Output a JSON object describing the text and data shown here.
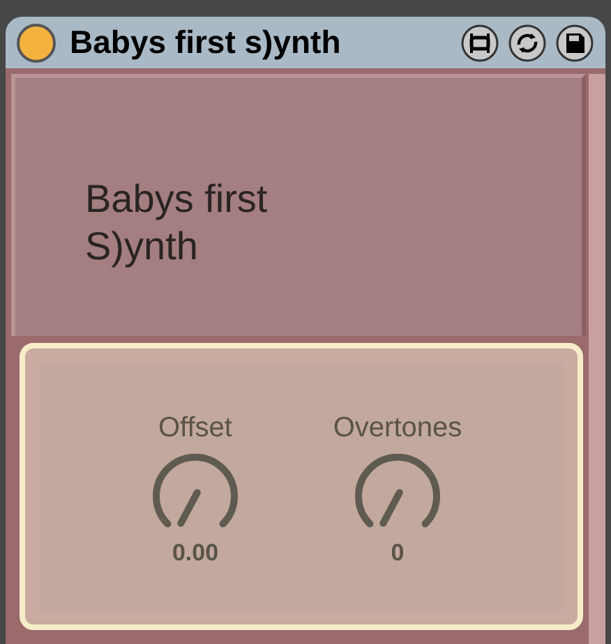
{
  "window": {
    "title": "Babys first s)ynth",
    "active": true
  },
  "header": {
    "title": "Babys first S)ynth"
  },
  "knobs": [
    {
      "label": "Offset",
      "reading": "0.00"
    },
    {
      "label": "Overtones",
      "reading": "0"
    }
  ]
}
